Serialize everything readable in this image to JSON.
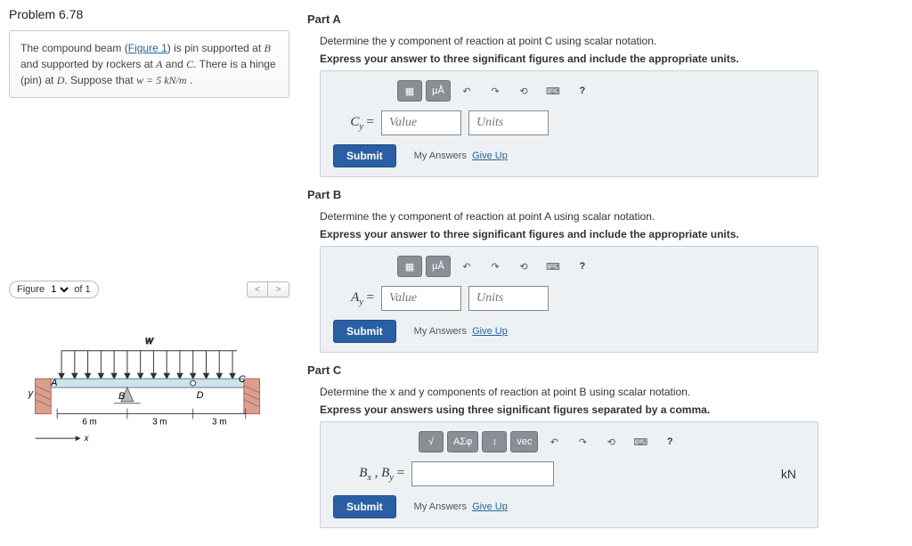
{
  "problem": {
    "title": "Problem 6.78",
    "desc_pre": "The compound beam (",
    "figure_link": "Figure 1",
    "desc_mid": ") is pin supported at ",
    "pt_B": "B",
    "desc_mid2": " and supported by rockers at ",
    "pt_A": "A",
    "and": " and ",
    "pt_C": "C",
    "desc_mid3": ". There is a hinge (pin) at ",
    "pt_D": "D",
    "desc_mid4": ". Suppose that ",
    "w_eq": "w = 5 kN/m",
    "period": " ."
  },
  "figure": {
    "label": "Figure",
    "num": "1",
    "of": "of 1",
    "labels": {
      "w": "w",
      "A": "A",
      "B": "B",
      "C": "C",
      "D": "D",
      "y": "y",
      "x": "x",
      "d1": "6 m",
      "d2": "3 m",
      "d3": "3 m"
    }
  },
  "parts": {
    "A": {
      "title": "Part A",
      "prompt": "Determine the y component of reaction at point C using scalar notation.",
      "instr": "Express your answer to three significant figures and include the appropriate units.",
      "lhs": "C",
      "sub": "y",
      "val_ph": "Value",
      "unit_ph": "Units",
      "submit": "Submit",
      "my_answers": "My Answers",
      "give_up": "Give Up",
      "tb": {
        "units": "µÅ"
      }
    },
    "B": {
      "title": "Part B",
      "prompt": "Determine the y component of reaction at point A using scalar notation.",
      "instr": "Express your answer to three significant figures and include the appropriate units.",
      "lhs": "A",
      "sub": "y",
      "val_ph": "Value",
      "unit_ph": "Units",
      "submit": "Submit",
      "my_answers": "My Answers",
      "give_up": "Give Up",
      "tb": {
        "units": "µÅ"
      }
    },
    "C": {
      "title": "Part C",
      "prompt": "Determine the x and y components of reaction at point B using scalar notation.",
      "instr": "Express your answers using three significant figures separated by a comma.",
      "lhs": "B",
      "sub1": "x",
      "sub2": "y",
      "unit": "kN",
      "submit": "Submit",
      "my_answers": "My Answers",
      "give_up": "Give Up",
      "tb": {
        "sigma": "ΑΣφ",
        "vec": "vec"
      }
    }
  }
}
